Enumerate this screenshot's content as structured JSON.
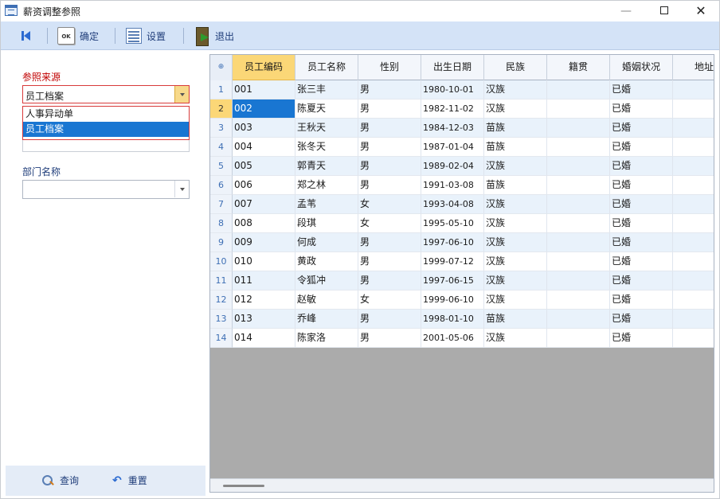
{
  "window": {
    "title": "薪资调整参照",
    "minimize_glyph": "—",
    "close_glyph": "✕"
  },
  "toolbar": {
    "first_icon": "first-record-icon",
    "ok_icon_text": "OK",
    "ok_label": "确定",
    "settings_label": "设置",
    "exit_label": "退出"
  },
  "left": {
    "source_label": "参照来源",
    "source_value": "员工档案",
    "source_options": [
      "人事异动单",
      "员工档案"
    ],
    "dept_label": "部门名称",
    "dept_value": "",
    "query_label": "查询",
    "reset_label": "重置",
    "reset_glyph": "↶"
  },
  "grid": {
    "row_header_icon": "⊕",
    "columns": [
      "员工编码",
      "员工名称",
      "性别",
      "出生日期",
      "民族",
      "籍贯",
      "婚姻状况",
      "地址"
    ],
    "rows": [
      {
        "n": "1",
        "code": "001",
        "name": "张三丰",
        "sex": "男",
        "birth": "1980-10-01",
        "nation": "汉族",
        "origin": "",
        "marital": "已婚",
        "addr": ""
      },
      {
        "n": "2",
        "code": "002",
        "name": "陈夏天",
        "sex": "男",
        "birth": "1982-11-02",
        "nation": "汉族",
        "origin": "",
        "marital": "已婚",
        "addr": ""
      },
      {
        "n": "3",
        "code": "003",
        "name": "王秋天",
        "sex": "男",
        "birth": "1984-12-03",
        "nation": "苗族",
        "origin": "",
        "marital": "已婚",
        "addr": ""
      },
      {
        "n": "4",
        "code": "004",
        "name": "张冬天",
        "sex": "男",
        "birth": "1987-01-04",
        "nation": "苗族",
        "origin": "",
        "marital": "已婚",
        "addr": ""
      },
      {
        "n": "5",
        "code": "005",
        "name": "郭青天",
        "sex": "男",
        "birth": "1989-02-04",
        "nation": "汉族",
        "origin": "",
        "marital": "已婚",
        "addr": ""
      },
      {
        "n": "6",
        "code": "006",
        "name": "郑之林",
        "sex": "男",
        "birth": "1991-03-08",
        "nation": "苗族",
        "origin": "",
        "marital": "已婚",
        "addr": ""
      },
      {
        "n": "7",
        "code": "007",
        "name": "孟苇",
        "sex": "女",
        "birth": "1993-04-08",
        "nation": "汉族",
        "origin": "",
        "marital": "已婚",
        "addr": ""
      },
      {
        "n": "8",
        "code": "008",
        "name": "段琪",
        "sex": "女",
        "birth": "1995-05-10",
        "nation": "汉族",
        "origin": "",
        "marital": "已婚",
        "addr": ""
      },
      {
        "n": "9",
        "code": "009",
        "name": "何成",
        "sex": "男",
        "birth": "1997-06-10",
        "nation": "汉族",
        "origin": "",
        "marital": "已婚",
        "addr": ""
      },
      {
        "n": "10",
        "code": "010",
        "name": "黄政",
        "sex": "男",
        "birth": "1999-07-12",
        "nation": "汉族",
        "origin": "",
        "marital": "已婚",
        "addr": ""
      },
      {
        "n": "11",
        "code": "011",
        "name": "令狐冲",
        "sex": "男",
        "birth": "1997-06-15",
        "nation": "汉族",
        "origin": "",
        "marital": "已婚",
        "addr": ""
      },
      {
        "n": "12",
        "code": "012",
        "name": "赵敏",
        "sex": "女",
        "birth": "1999-06-10",
        "nation": "汉族",
        "origin": "",
        "marital": "已婚",
        "addr": ""
      },
      {
        "n": "13",
        "code": "013",
        "name": "乔峰",
        "sex": "男",
        "birth": "1998-01-10",
        "nation": "苗族",
        "origin": "",
        "marital": "已婚",
        "addr": ""
      },
      {
        "n": "14",
        "code": "014",
        "name": "陈家洛",
        "sex": "男",
        "birth": "2001-05-06",
        "nation": "汉族",
        "origin": "",
        "marital": "已婚",
        "addr": ""
      }
    ]
  },
  "colors": {
    "accent": "#1976d2",
    "toolbar_bg": "#d4e3f7",
    "sorted_header": "#fbd777",
    "required_label": "#c00000"
  }
}
